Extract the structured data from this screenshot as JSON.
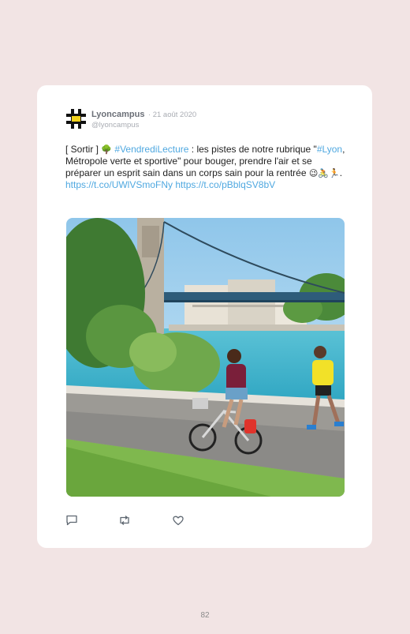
{
  "tweet": {
    "author_name": "Lyoncampus",
    "date": "· 21 août 2020",
    "handle": "@lyoncampus",
    "text": {
      "prefix": "[ Sortir ] ",
      "emoji_tree": "🌳",
      "hashtag1": "#VendrediLecture",
      "part2": " : les pistes de notre rubrique \"",
      "hashtag2": "#Lyon",
      "part3": ", Métropole verte et sportive\" pour bouger, prendre l'air et se préparer un esprit sain dans un corps sain pour la rentrée ",
      "emojis_end": "😉🚴🏃",
      "part4": ".",
      "link1": "https://t.co/UWlVSmoFNy",
      "link2": "https://t.co/pBblqSV8bV"
    },
    "icons": {
      "avatar": "hashtag-logo-icon",
      "reply": "comment-icon",
      "retweet": "retweet-icon",
      "like": "heart-icon"
    }
  },
  "page_number": "82",
  "colors": {
    "background": "#f2e4e4",
    "card": "#ffffff",
    "link": "#4fa8e0",
    "muted": "#a9acb3"
  }
}
